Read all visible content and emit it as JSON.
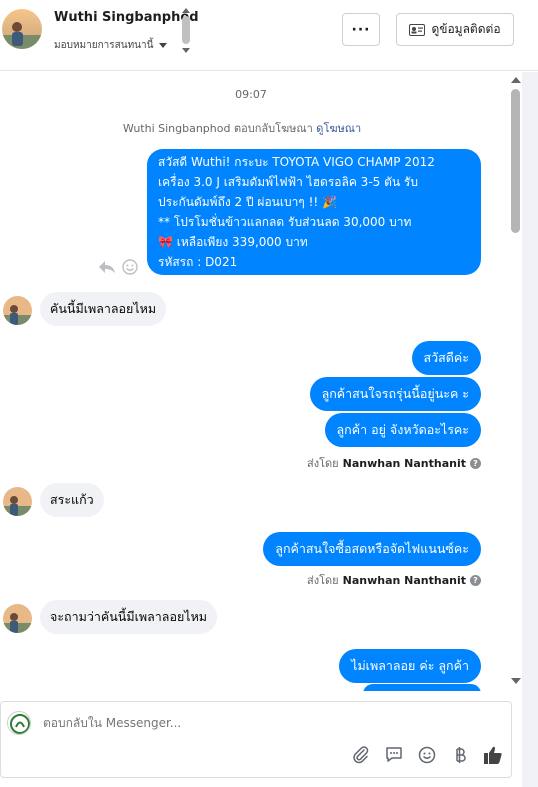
{
  "header": {
    "contact_name": "Wuthi Singbanphod",
    "assign_label": "มอบหมายการสนทนานี้",
    "more_label": "···",
    "contact_info_label": "ดูข้อมูลติดต่อ"
  },
  "chat": {
    "timestamp": "09:07",
    "ad_reply_prefix": "Wuthi Singbanphod ตอบกลับโฆษณา",
    "ad_reply_link": "ดูโฆษณา",
    "ad_message_lines": [
      "สวัสดี Wuthi! กระบะ TOYOTA VIGO CHAMP 2012",
      "เครื่อง 3.0 J เสริมดัมพ์ไฟฟ้า ไฮดรอลิค 3-5 ตัน รับ",
      "ประกันดัมพ์ถึง 2 ปี ผ่อนเบาๆ !! 🎉",
      "** โปรโมชั่นข้าวแลกลด รับส่วนลด 30,000 บาท",
      "🎀 เหลือเพียง 339,000 บาท",
      " รหัสรถ : D021"
    ],
    "messages": [
      {
        "dir": "in",
        "text": "คันนี้มีเพลาลอยไหม"
      },
      {
        "dir": "out",
        "text": "สวัสดีค่ะ"
      },
      {
        "dir": "out",
        "text": "ลูกค้าสนใจรถรุ่นนี้อยู่นะค ะ"
      },
      {
        "dir": "out",
        "text": "ลูกค้า อยู่ จังหวัดอะไรคะ"
      },
      {
        "dir": "in",
        "text": "สระแก้ว"
      },
      {
        "dir": "out",
        "text": "ลูกค้าสนใจซื้อสดหรือจัดไฟแนนซ์คะ"
      },
      {
        "dir": "in",
        "text": "จะถามว่าคันนี้มีเพลาลอยไหม"
      },
      {
        "dir": "out",
        "text": "ไม่เพลาลอย ค่ะ ลูกค้า"
      }
    ],
    "sent_by_prefix": "ส่งโดย",
    "sent_by_name": "Nanwhan Nanthanit",
    "help_glyph": "?"
  },
  "composer": {
    "placeholder": "ตอบกลับใน Messenger..."
  },
  "colors": {
    "accent": "#0084ff",
    "incoming_bg": "#f0f2f5"
  }
}
